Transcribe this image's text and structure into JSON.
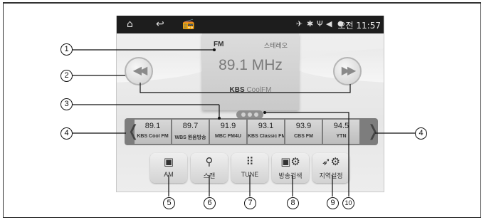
{
  "status_bar": {
    "clock": "오전 11:57",
    "left_icons": [
      "home-icon",
      "back-icon",
      "radio-app-icon"
    ],
    "right_icons": [
      "mute-icon",
      "bluetooth-icon",
      "usb-icon",
      "volume-icon",
      "location-icon"
    ]
  },
  "now_playing": {
    "band": "FM",
    "stereo": "스테레오",
    "frequency": "89.1 MHz",
    "station_brand": "KBS",
    "station_name": "CoolFM"
  },
  "presets": [
    {
      "freq": "89.1",
      "logo": "KBS Cool FM"
    },
    {
      "freq": "89.7",
      "logo": "WBS 원음방송"
    },
    {
      "freq": "91.9",
      "logo": "MBC FM4U"
    },
    {
      "freq": "93.1",
      "logo": "KBS Classic FM"
    },
    {
      "freq": "93.9",
      "logo": "CBS FM"
    },
    {
      "freq": "94.5",
      "logo": "YTN"
    }
  ],
  "function_buttons": [
    {
      "label": "AM",
      "icon": "radio-icon"
    },
    {
      "label": "스캔",
      "icon": "search-icon"
    },
    {
      "label": "TUNE",
      "icon": "keypad-icon"
    },
    {
      "label": "방송검색",
      "icon": "radio-settings-icon"
    },
    {
      "label": "지역설정",
      "icon": "region-settings-icon"
    }
  ],
  "callouts": [
    "1",
    "2",
    "3",
    "4",
    "4",
    "5",
    "6",
    "7",
    "8",
    "9",
    "10"
  ]
}
